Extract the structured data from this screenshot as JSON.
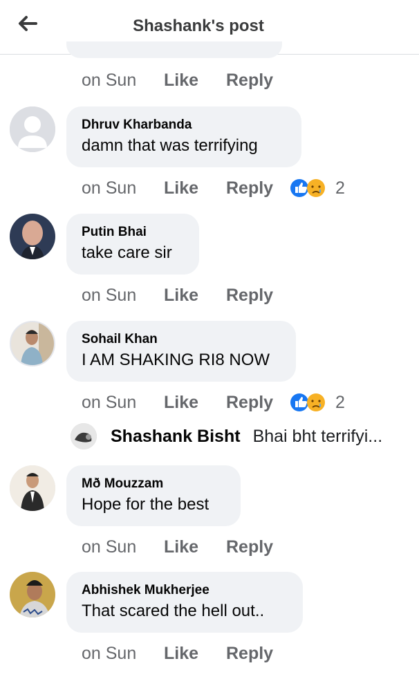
{
  "header": {
    "title": "Shashank's post",
    "back_icon": "arrow-left-icon"
  },
  "comments": [
    {
      "author": "Dhruv Kharbanda",
      "text": "damn that was terrifying",
      "time": "on Sun",
      "like": "Like",
      "reply": "Reply",
      "reactions": {
        "icons": [
          "like-icon",
          "sad-icon"
        ],
        "count": "2"
      }
    },
    {
      "author": "Putin Bhai",
      "text": "take care sir",
      "time": "on Sun",
      "like": "Like",
      "reply": "Reply"
    },
    {
      "author": "Sohail Khan",
      "text": "I AM SHAKING RI8 NOW",
      "time": "on Sun",
      "like": "Like",
      "reply": "Reply",
      "reactions": {
        "icons": [
          "like-icon",
          "sad-icon"
        ],
        "count": "2"
      }
    },
    {
      "author": "Mð Mouzzam",
      "text": "Hope for the best",
      "time": "on Sun",
      "like": "Like",
      "reply": "Reply"
    },
    {
      "author": "Abhishek Mukherjee",
      "text": "That scared the hell out..",
      "time": "on Sun",
      "like": "Like",
      "reply": "Reply"
    }
  ],
  "previous_actions": {
    "time": "on Sun",
    "like": "Like",
    "reply": "Reply"
  },
  "reply_preview": {
    "author": "Shashank Bisht",
    "text": "Bhai bht terrifyi..."
  },
  "colors": {
    "bubble": "#f0f2f5",
    "meta": "#65676b",
    "like_blue": "#1877f2",
    "sad_yellow": "#f7b125"
  }
}
